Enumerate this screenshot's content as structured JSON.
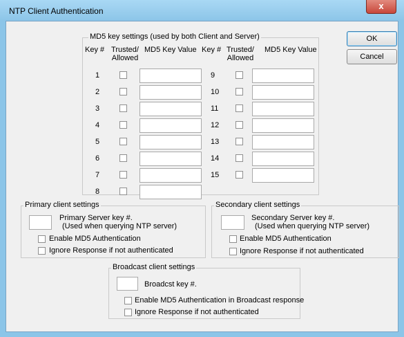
{
  "window": {
    "title": "NTP Client Authentication",
    "close_glyph": "x"
  },
  "buttons": {
    "ok": "OK",
    "cancel": "Cancel"
  },
  "md5": {
    "title": "MD5 key settings (used by both Client and Server)",
    "col_key": "Key #",
    "col_trusted_line1": "Trusted/",
    "col_trusted_line2": "Allowed",
    "col_value": "MD5 Key Value",
    "left_keys": [
      "1",
      "2",
      "3",
      "4",
      "5",
      "6",
      "7",
      "8"
    ],
    "right_keys": [
      "9",
      "10",
      "11",
      "12",
      "13",
      "14",
      "15"
    ]
  },
  "primary": {
    "title": "Primary client settings",
    "key_label_line1": "Primary Server key #.",
    "key_label_line2": "(Used when querying NTP server)",
    "enable_md5": "Enable MD5 Authentication",
    "ignore": "Ignore Response if not authenticated"
  },
  "secondary": {
    "title": "Secondary client settings",
    "key_label_line1": "Secondary Server key #.",
    "key_label_line2": "(Used when querying NTP server)",
    "enable_md5": "Enable MD5 Authentication",
    "ignore": "Ignore Response if not authenticated"
  },
  "broadcast": {
    "title": "Broadcast client settings",
    "key_label": "Broadcst key #.",
    "enable_md5": "Enable MD5 Authentication in Broadcast response",
    "ignore": "Ignore Response if not authenticated"
  }
}
